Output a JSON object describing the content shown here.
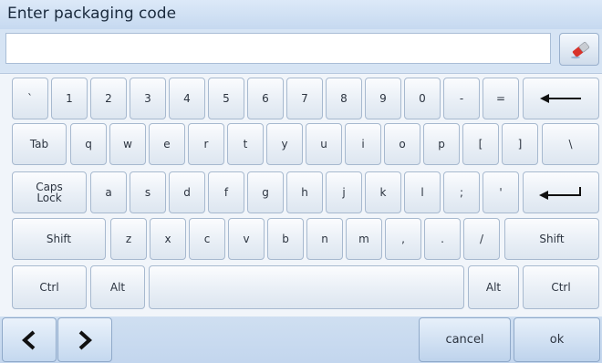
{
  "window": {
    "title": "Enter packaging code"
  },
  "input": {
    "value": "",
    "placeholder": ""
  },
  "eraser": {
    "icon": "eraser-icon"
  },
  "keyboard": {
    "row1": [
      "`",
      "1",
      "2",
      "3",
      "4",
      "5",
      "6",
      "7",
      "8",
      "9",
      "0",
      "-",
      "="
    ],
    "row2": {
      "tab": "Tab",
      "keys": [
        "q",
        "w",
        "e",
        "r",
        "t",
        "y",
        "u",
        "i",
        "o",
        "p",
        "[",
        "]",
        "\\"
      ]
    },
    "row3": {
      "caps": "Caps Lock",
      "keys": [
        "a",
        "s",
        "d",
        "f",
        "g",
        "h",
        "j",
        "k",
        "l",
        ";",
        "'"
      ]
    },
    "row4": {
      "shift_left": "Shift",
      "keys": [
        "z",
        "x",
        "c",
        "v",
        "b",
        "n",
        "m",
        ",",
        ".",
        "/"
      ],
      "shift_right": "Shift"
    },
    "row5": {
      "ctrl_left": "Ctrl",
      "alt_left": "Alt",
      "alt_right": "Alt",
      "ctrl_right": "Ctrl"
    }
  },
  "bottom": {
    "cancel": "cancel",
    "ok": "ok"
  }
}
